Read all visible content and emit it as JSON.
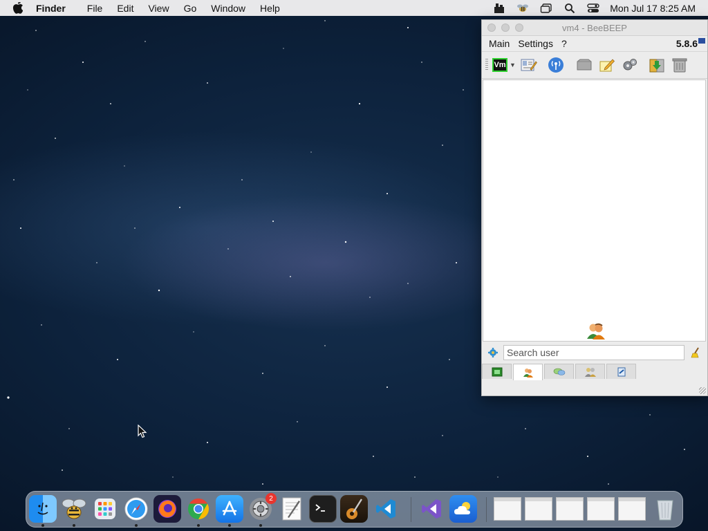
{
  "menubar": {
    "app_name": "Finder",
    "items": [
      "File",
      "Edit",
      "View",
      "Go",
      "Window",
      "Help"
    ],
    "clock": "Mon Jul 17  8:25 AM"
  },
  "window": {
    "title": "vm4 - BeeBEEP",
    "menu": [
      "Main",
      "Settings",
      "?"
    ],
    "version": "5.8.6",
    "toolbar": {
      "profile_label": "Vm"
    },
    "search": {
      "placeholder": "Search user",
      "value": ""
    }
  },
  "dock": {
    "settings_badge": "2"
  },
  "colors": {
    "menubar_bg": "#e8e8ea",
    "window_bg": "#ececec",
    "accent_green": "#2fd12f",
    "badge_red": "#e8352e"
  }
}
